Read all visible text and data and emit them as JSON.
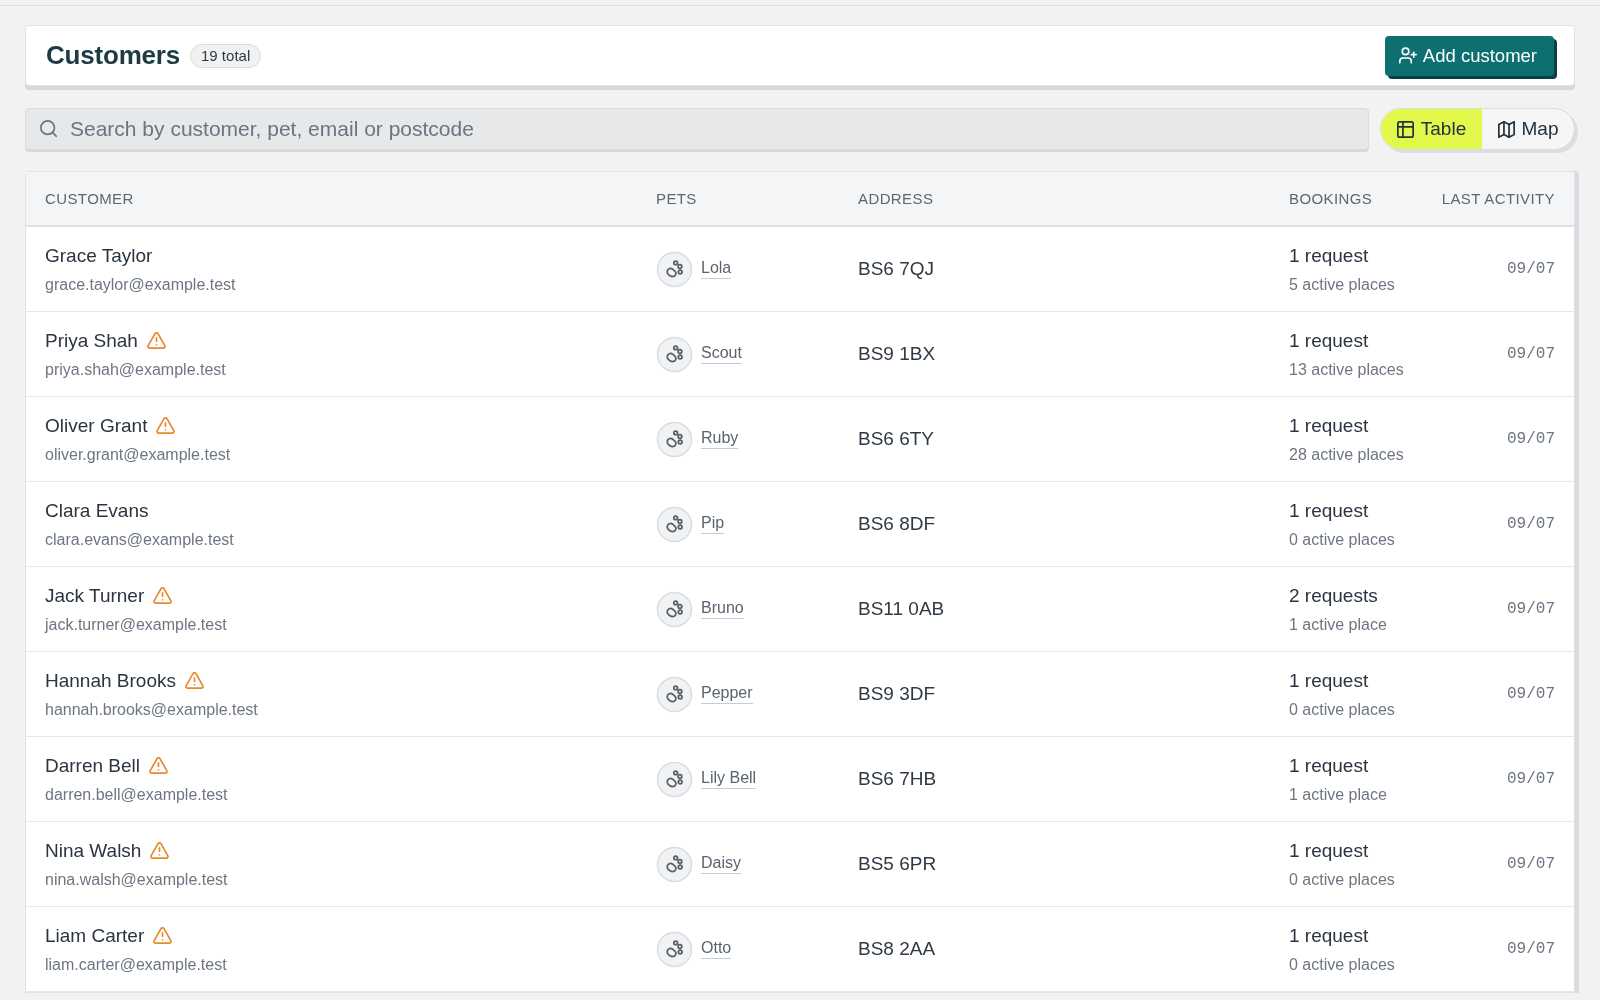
{
  "header": {
    "title": "Customers",
    "count_badge": "19 total",
    "add_button": "Add customer"
  },
  "search": {
    "placeholder": "Search by customer, pet, email or postcode"
  },
  "view_toggle": [
    {
      "kind": "table",
      "label": "Table",
      "selected": true
    },
    {
      "kind": "map",
      "label": "Map",
      "selected": false
    }
  ],
  "table": {
    "columns": [
      "CUSTOMER",
      "PETS",
      "ADDRESS",
      "BOOKINGS",
      "LAST ACTIVITY"
    ],
    "rows": [
      {
        "name": "Grace Taylor",
        "warning": false,
        "email": "grace.taylor@example.test",
        "pet": "Lola",
        "address": "BS6 7QJ",
        "bookings": "1 request",
        "active_places": "5 active places",
        "last_activity": "09/07"
      },
      {
        "name": "Priya Shah",
        "warning": true,
        "email": "priya.shah@example.test",
        "pet": "Scout",
        "address": "BS9 1BX",
        "bookings": "1 request",
        "active_places": "13 active places",
        "last_activity": "09/07"
      },
      {
        "name": "Oliver Grant",
        "warning": true,
        "email": "oliver.grant@example.test",
        "pet": "Ruby",
        "address": "BS6 6TY",
        "bookings": "1 request",
        "active_places": "28 active places",
        "last_activity": "09/07"
      },
      {
        "name": "Clara Evans",
        "warning": false,
        "email": "clara.evans@example.test",
        "pet": "Pip",
        "address": "BS6 8DF",
        "bookings": "1 request",
        "active_places": "0 active places",
        "last_activity": "09/07"
      },
      {
        "name": "Jack Turner",
        "warning": true,
        "email": "jack.turner@example.test",
        "pet": "Bruno",
        "address": "BS11 0AB",
        "bookings": "2 requests",
        "active_places": "1 active place",
        "last_activity": "09/07"
      },
      {
        "name": "Hannah Brooks",
        "warning": true,
        "email": "hannah.brooks@example.test",
        "pet": "Pepper",
        "address": "BS9 3DF",
        "bookings": "1 request",
        "active_places": "0 active places",
        "last_activity": "09/07"
      },
      {
        "name": "Darren Bell",
        "warning": true,
        "email": "darren.bell@example.test",
        "pet": "Lily Bell",
        "address": "BS6 7HB",
        "bookings": "1 request",
        "active_places": "1 active place",
        "last_activity": "09/07"
      },
      {
        "name": "Nina Walsh",
        "warning": true,
        "email": "nina.walsh@example.test",
        "pet": "Daisy",
        "address": "BS5 6PR",
        "bookings": "1 request",
        "active_places": "0 active places",
        "last_activity": "09/07"
      },
      {
        "name": "Liam Carter",
        "warning": true,
        "email": "liam.carter@example.test",
        "pet": "Otto",
        "address": "BS8 2AA",
        "bookings": "1 request",
        "active_places": "0 active places",
        "last_activity": "09/07"
      }
    ]
  }
}
